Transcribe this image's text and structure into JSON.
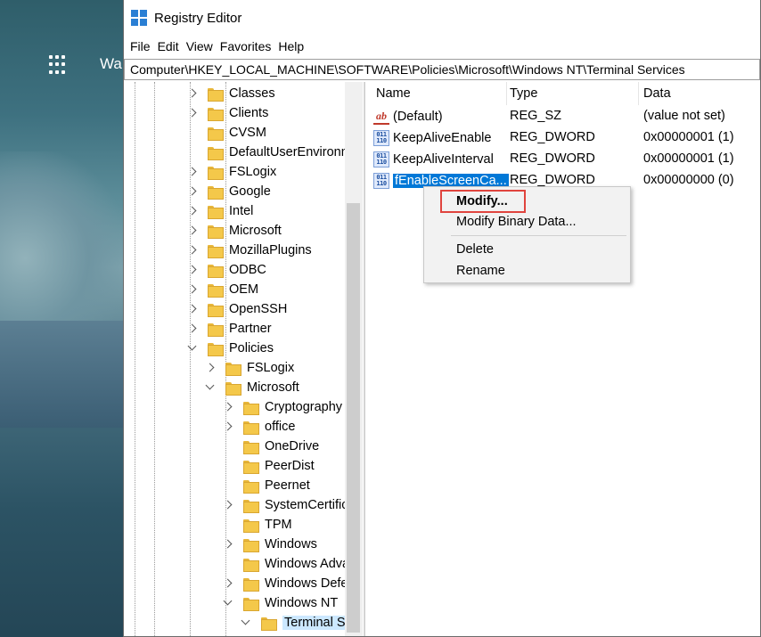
{
  "desktop": {
    "partial_text": "Wa"
  },
  "window": {
    "title": "Registry Editor",
    "menu": [
      "File",
      "Edit",
      "View",
      "Favorites",
      "Help"
    ],
    "address": "Computer\\HKEY_LOCAL_MACHINE\\SOFTWARE\\Policies\\Microsoft\\Windows NT\\Terminal Services"
  },
  "tree": {
    "items": [
      {
        "label": "Classes",
        "level": 0,
        "chevron": "right"
      },
      {
        "label": "Clients",
        "level": 0,
        "chevron": "right"
      },
      {
        "label": "CVSM",
        "level": 0,
        "chevron": "none"
      },
      {
        "label": "DefaultUserEnvironm",
        "level": 0,
        "chevron": "none"
      },
      {
        "label": "FSLogix",
        "level": 0,
        "chevron": "right"
      },
      {
        "label": "Google",
        "level": 0,
        "chevron": "right"
      },
      {
        "label": "Intel",
        "level": 0,
        "chevron": "right"
      },
      {
        "label": "Microsoft",
        "level": 0,
        "chevron": "right"
      },
      {
        "label": "MozillaPlugins",
        "level": 0,
        "chevron": "right"
      },
      {
        "label": "ODBC",
        "level": 0,
        "chevron": "right"
      },
      {
        "label": "OEM",
        "level": 0,
        "chevron": "right"
      },
      {
        "label": "OpenSSH",
        "level": 0,
        "chevron": "right"
      },
      {
        "label": "Partner",
        "level": 0,
        "chevron": "right"
      },
      {
        "label": "Policies",
        "level": 0,
        "chevron": "down"
      },
      {
        "label": "FSLogix",
        "level": 1,
        "chevron": "right"
      },
      {
        "label": "Microsoft",
        "level": 1,
        "chevron": "down"
      },
      {
        "label": "Cryptography",
        "level": 2,
        "chevron": "right"
      },
      {
        "label": "office",
        "level": 2,
        "chevron": "right"
      },
      {
        "label": "OneDrive",
        "level": 2,
        "chevron": "none"
      },
      {
        "label": "PeerDist",
        "level": 2,
        "chevron": "none"
      },
      {
        "label": "Peernet",
        "level": 2,
        "chevron": "none"
      },
      {
        "label": "SystemCertifica",
        "level": 2,
        "chevron": "right"
      },
      {
        "label": "TPM",
        "level": 2,
        "chevron": "none"
      },
      {
        "label": "Windows",
        "level": 2,
        "chevron": "right"
      },
      {
        "label": "Windows Adva",
        "level": 2,
        "chevron": "none"
      },
      {
        "label": "Windows Defe",
        "level": 2,
        "chevron": "right"
      },
      {
        "label": "Windows NT",
        "level": 2,
        "chevron": "down"
      },
      {
        "label": "Terminal Se",
        "level": 3,
        "chevron": "down",
        "selected": true
      }
    ]
  },
  "list": {
    "columns": [
      "Name",
      "Type",
      "Data"
    ],
    "rows": [
      {
        "icon": "string-value-icon",
        "name": "(Default)",
        "type": "REG_SZ",
        "data": "(value not set)"
      },
      {
        "icon": "binary-value-icon",
        "name": "KeepAliveEnable",
        "type": "REG_DWORD",
        "data": "0x00000001 (1)"
      },
      {
        "icon": "binary-value-icon",
        "name": "KeepAliveInterval",
        "type": "REG_DWORD",
        "data": "0x00000001 (1)"
      },
      {
        "icon": "binary-value-icon",
        "name": "fEnableScreenCa...",
        "type": "REG_DWORD",
        "data": "0x00000000 (0)",
        "selected": true
      }
    ]
  },
  "context_menu": {
    "items": [
      "Modify...",
      "Modify Binary Data...",
      "Delete",
      "Rename"
    ]
  },
  "colors": {
    "selection": "#0078d7",
    "highlight_box": "#e0443e",
    "folder": "#f4c84a"
  }
}
